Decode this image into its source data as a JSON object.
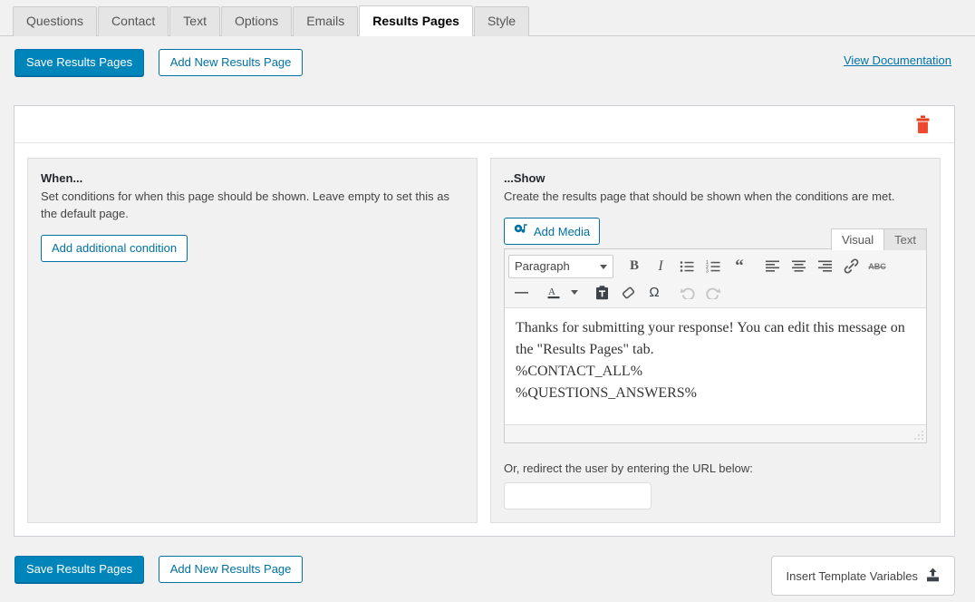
{
  "tabs": [
    {
      "label": "Questions",
      "active": false
    },
    {
      "label": "Contact",
      "active": false
    },
    {
      "label": "Text",
      "active": false
    },
    {
      "label": "Options",
      "active": false
    },
    {
      "label": "Emails",
      "active": false
    },
    {
      "label": "Results Pages",
      "active": true
    },
    {
      "label": "Style",
      "active": false
    }
  ],
  "toolbar": {
    "save_label": "Save Results Pages",
    "add_new_label": "Add New Results Page",
    "documentation_label": "View Documentation"
  },
  "page_box": {
    "delete_icon": "trash-icon",
    "delete_color": "#e2401c"
  },
  "when_panel": {
    "title": "When...",
    "description": "Set conditions for when this page should be shown. Leave empty to set this as the default page.",
    "add_condition_label": "Add additional condition"
  },
  "show_panel": {
    "title": "...Show",
    "description": "Create the results page that should be shown when the conditions are met.",
    "add_media_label": "Add Media",
    "add_media_icon": "media-icon",
    "editor_tabs": [
      {
        "label": "Visual",
        "active": true
      },
      {
        "label": "Text",
        "active": false
      }
    ],
    "format_select": "Paragraph",
    "toolbar_row1": [
      {
        "name": "bold-icon",
        "glyph": "B"
      },
      {
        "name": "italic-icon",
        "glyph": "I"
      },
      {
        "name": "bulleted-list-icon",
        "glyph": ""
      },
      {
        "name": "numbered-list-icon",
        "glyph": ""
      },
      {
        "name": "blockquote-icon",
        "glyph": "“"
      },
      {
        "name": "align-left-icon",
        "glyph": ""
      },
      {
        "name": "align-center-icon",
        "glyph": ""
      },
      {
        "name": "align-right-icon",
        "glyph": ""
      },
      {
        "name": "insert-link-icon",
        "glyph": ""
      },
      {
        "name": "strikethrough-icon",
        "glyph": "ABC"
      }
    ],
    "toolbar_row2": [
      {
        "name": "horizontal-rule-icon",
        "glyph": "—"
      },
      {
        "name": "text-color-icon",
        "glyph": "A"
      },
      {
        "name": "text-color-dropdown-icon",
        "glyph": ""
      },
      {
        "name": "paste-as-text-icon",
        "glyph": ""
      },
      {
        "name": "clear-formatting-icon",
        "glyph": ""
      },
      {
        "name": "special-character-icon",
        "glyph": "Ω"
      },
      {
        "name": "undo-icon",
        "glyph": ""
      },
      {
        "name": "redo-icon",
        "glyph": ""
      }
    ],
    "editor_content": [
      "Thanks for submitting your response! You can edit this message on the \"Results Pages\" tab.",
      "%CONTACT_ALL%",
      "%QUESTIONS_ANSWERS%"
    ],
    "redirect_label": "Or, redirect the user by entering the URL below:",
    "redirect_value": "",
    "redirect_placeholder": ""
  },
  "bottom": {
    "save_label": "Save Results Pages",
    "add_new_label": "Add New Results Page",
    "insert_variables_label": "Insert Template Variables",
    "insert_variables_icon": "upload-icon"
  },
  "colors": {
    "accent": "#0085ba",
    "link": "#0073aa",
    "danger": "#e2401c",
    "page_bg": "#f1f1f1"
  }
}
